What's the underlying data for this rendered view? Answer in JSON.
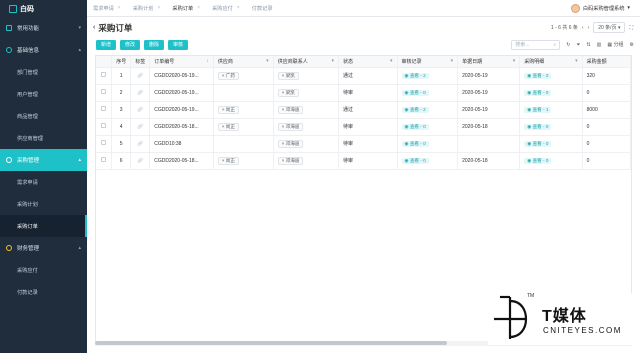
{
  "app": {
    "name": "白码"
  },
  "sidebar": {
    "groups": [
      {
        "label": "常用功能",
        "icon": "star-icon"
      },
      {
        "label": "基础信息",
        "icon": "circle-icon",
        "items": [
          "部门管理",
          "用户管理",
          "商品管理",
          "供应商管理"
        ]
      },
      {
        "label": "采购管理",
        "icon": "circle-icon",
        "items": [
          "需求申请",
          "采购计划",
          "采购订单"
        ]
      },
      {
        "label": "财务管理",
        "icon": "circle-icon",
        "items": [
          "采购应付",
          "付款记录"
        ]
      }
    ]
  },
  "tabs": [
    "需求申请",
    "采购计划",
    "采购订单",
    "采购应付",
    "付款记录"
  ],
  "user": {
    "name": "白码采购管理系统"
  },
  "page": {
    "title": "采购订单"
  },
  "pager": {
    "range": "1 - 6 共 6 条",
    "per_page": "20 条/页"
  },
  "toolbar": {
    "buttons": [
      "新增",
      "修改",
      "删除",
      "审核"
    ],
    "search_placeholder": "搜索...",
    "group_label": "分组"
  },
  "table": {
    "headers": [
      "序号",
      "标签",
      "订单编号",
      "供应商",
      "供应商联系人",
      "状态",
      "审核记录",
      "单据日期",
      "采购明细",
      "采购金额"
    ],
    "rows": [
      {
        "no": "1",
        "order": "CGDD2020-05-19...",
        "supplier": "广药",
        "contact": "梁凯",
        "status": "通过",
        "audit": "查看 - 2",
        "date": "2020-05-19",
        "detail": "查看 - 2",
        "amount": "320"
      },
      {
        "no": "2",
        "order": "CGDD2020-05-19...",
        "supplier": "",
        "contact": "梁凯",
        "status": "待审",
        "audit": "查看 - 0",
        "date": "2020-05-19",
        "detail": "查看 - 0",
        "amount": "0"
      },
      {
        "no": "3",
        "order": "CGDD2020-05-19...",
        "supplier": "尚正",
        "contact": "邓海迪",
        "status": "通过",
        "audit": "查看 - 2",
        "date": "2020-05-19",
        "detail": "查看 - 1",
        "amount": "8000"
      },
      {
        "no": "4",
        "order": "CGDD2020-05-18...",
        "supplier": "尚正",
        "contact": "邓海迪",
        "status": "待审",
        "audit": "查看 - 0",
        "date": "2020-05-18",
        "detail": "查看 - 0",
        "amount": "0"
      },
      {
        "no": "5",
        "order": "CGDD10:38",
        "supplier": "",
        "contact": "邓海迪",
        "status": "待审",
        "audit": "查看 - 0",
        "date": "",
        "detail": "查看 - 0",
        "amount": "0"
      },
      {
        "no": "6",
        "order": "CGDD2020-05-18...",
        "supplier": "尚正",
        "contact": "邓海迪",
        "status": "待审",
        "audit": "查看 - 0",
        "date": "2020-05-18",
        "detail": "查看 - 0",
        "amount": "0"
      }
    ]
  },
  "watermark": {
    "line1": "T媒体",
    "line2": "CNITEYES.COM",
    "tm": "TM"
  },
  "colors": {
    "accent": "#1fc1c9",
    "sidebar_bg": "#1f2d3d",
    "warning_icon": "#f7c325"
  }
}
